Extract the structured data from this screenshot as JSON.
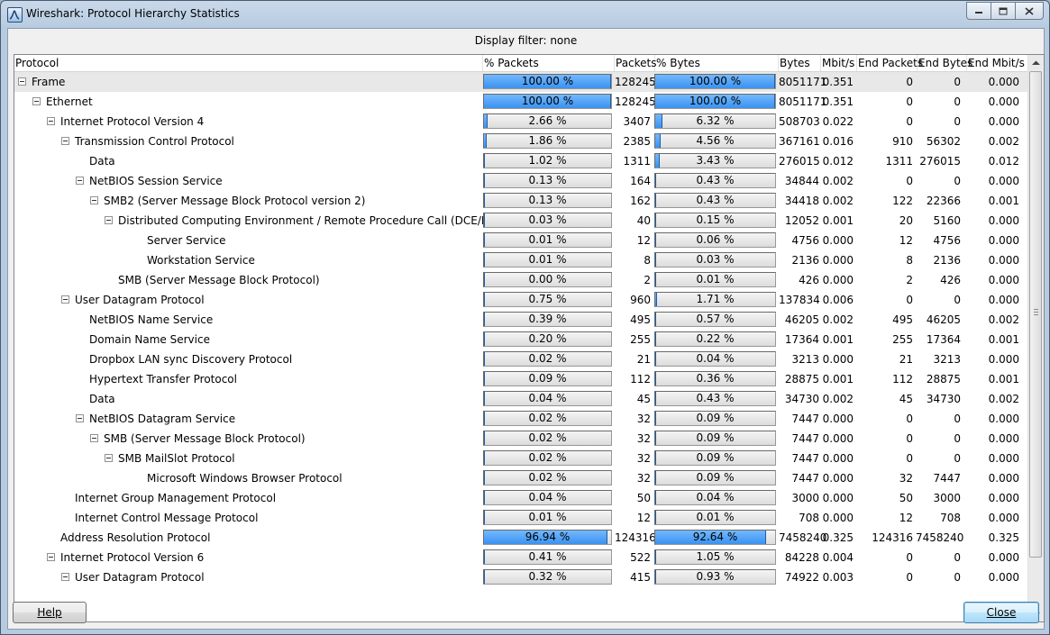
{
  "window": {
    "title": "Wireshark: Protocol Hierarchy Statistics"
  },
  "filter_text": "Display filter: none",
  "columns": [
    "Protocol",
    "% Packets",
    "Packets",
    "% Bytes",
    "Bytes",
    "Mbit/s",
    "End Packets",
    "End Bytes",
    "End Mbit/s"
  ],
  "rows": [
    {
      "protocol": "Frame",
      "level": 0,
      "expander": true,
      "selected": true,
      "pct_packets": "100.00 %",
      "pct_packets_value": 100.0,
      "packets": "128245",
      "pct_bytes": "100.00 %",
      "pct_bytes_value": 100.0,
      "bytes": "8051171",
      "mbits": "0.351",
      "end_packets": "0",
      "end_bytes": "0",
      "end_mbits": "0.000"
    },
    {
      "protocol": "Ethernet",
      "level": 1,
      "expander": true,
      "pct_packets": "100.00 %",
      "pct_packets_value": 100.0,
      "packets": "128245",
      "pct_bytes": "100.00 %",
      "pct_bytes_value": 100.0,
      "bytes": "8051171",
      "mbits": "0.351",
      "end_packets": "0",
      "end_bytes": "0",
      "end_mbits": "0.000"
    },
    {
      "protocol": "Internet Protocol Version 4",
      "level": 2,
      "expander": true,
      "pct_packets": "2.66 %",
      "pct_packets_value": 2.66,
      "packets": "3407",
      "pct_bytes": "6.32 %",
      "pct_bytes_value": 6.32,
      "bytes": "508703",
      "mbits": "0.022",
      "end_packets": "0",
      "end_bytes": "0",
      "end_mbits": "0.000"
    },
    {
      "protocol": "Transmission Control Protocol",
      "level": 3,
      "expander": true,
      "pct_packets": "1.86 %",
      "pct_packets_value": 1.86,
      "packets": "2385",
      "pct_bytes": "4.56 %",
      "pct_bytes_value": 4.56,
      "bytes": "367161",
      "mbits": "0.016",
      "end_packets": "910",
      "end_bytes": "56302",
      "end_mbits": "0.002"
    },
    {
      "protocol": "Data",
      "level": 4,
      "expander": false,
      "pct_packets": "1.02 %",
      "pct_packets_value": 1.02,
      "packets": "1311",
      "pct_bytes": "3.43 %",
      "pct_bytes_value": 3.43,
      "bytes": "276015",
      "mbits": "0.012",
      "end_packets": "1311",
      "end_bytes": "276015",
      "end_mbits": "0.012"
    },
    {
      "protocol": "NetBIOS Session Service",
      "level": 4,
      "expander": true,
      "pct_packets": "0.13 %",
      "pct_packets_value": 0.13,
      "packets": "164",
      "pct_bytes": "0.43 %",
      "pct_bytes_value": 0.43,
      "bytes": "34844",
      "mbits": "0.002",
      "end_packets": "0",
      "end_bytes": "0",
      "end_mbits": "0.000"
    },
    {
      "protocol": "SMB2 (Server Message Block Protocol version 2)",
      "level": 5,
      "expander": true,
      "pct_packets": "0.13 %",
      "pct_packets_value": 0.13,
      "packets": "162",
      "pct_bytes": "0.43 %",
      "pct_bytes_value": 0.43,
      "bytes": "34418",
      "mbits": "0.002",
      "end_packets": "122",
      "end_bytes": "22366",
      "end_mbits": "0.001"
    },
    {
      "protocol": "Distributed Computing Environment / Remote Procedure Call (DCE/RPC)",
      "level": 6,
      "expander": true,
      "pct_packets": "0.03 %",
      "pct_packets_value": 0.03,
      "packets": "40",
      "pct_bytes": "0.15 %",
      "pct_bytes_value": 0.15,
      "bytes": "12052",
      "mbits": "0.001",
      "end_packets": "20",
      "end_bytes": "5160",
      "end_mbits": "0.000"
    },
    {
      "protocol": "Server Service",
      "level": 8,
      "expander": false,
      "pct_packets": "0.01 %",
      "pct_packets_value": 0.01,
      "packets": "12",
      "pct_bytes": "0.06 %",
      "pct_bytes_value": 0.06,
      "bytes": "4756",
      "mbits": "0.000",
      "end_packets": "12",
      "end_bytes": "4756",
      "end_mbits": "0.000"
    },
    {
      "protocol": "Workstation Service",
      "level": 8,
      "expander": false,
      "pct_packets": "0.01 %",
      "pct_packets_value": 0.01,
      "packets": "8",
      "pct_bytes": "0.03 %",
      "pct_bytes_value": 0.03,
      "bytes": "2136",
      "mbits": "0.000",
      "end_packets": "8",
      "end_bytes": "2136",
      "end_mbits": "0.000"
    },
    {
      "protocol": "SMB (Server Message Block Protocol)",
      "level": 6,
      "expander": false,
      "pct_packets": "0.00 %",
      "pct_packets_value": 0.0,
      "packets": "2",
      "pct_bytes": "0.01 %",
      "pct_bytes_value": 0.01,
      "bytes": "426",
      "mbits": "0.000",
      "end_packets": "2",
      "end_bytes": "426",
      "end_mbits": "0.000"
    },
    {
      "protocol": "User Datagram Protocol",
      "level": 3,
      "expander": true,
      "pct_packets": "0.75 %",
      "pct_packets_value": 0.75,
      "packets": "960",
      "pct_bytes": "1.71 %",
      "pct_bytes_value": 1.71,
      "bytes": "137834",
      "mbits": "0.006",
      "end_packets": "0",
      "end_bytes": "0",
      "end_mbits": "0.000"
    },
    {
      "protocol": "NetBIOS Name Service",
      "level": 4,
      "expander": false,
      "pct_packets": "0.39 %",
      "pct_packets_value": 0.39,
      "packets": "495",
      "pct_bytes": "0.57 %",
      "pct_bytes_value": 0.57,
      "bytes": "46205",
      "mbits": "0.002",
      "end_packets": "495",
      "end_bytes": "46205",
      "end_mbits": "0.002"
    },
    {
      "protocol": "Domain Name Service",
      "level": 4,
      "expander": false,
      "pct_packets": "0.20 %",
      "pct_packets_value": 0.2,
      "packets": "255",
      "pct_bytes": "0.22 %",
      "pct_bytes_value": 0.22,
      "bytes": "17364",
      "mbits": "0.001",
      "end_packets": "255",
      "end_bytes": "17364",
      "end_mbits": "0.001"
    },
    {
      "protocol": "Dropbox LAN sync Discovery Protocol",
      "level": 4,
      "expander": false,
      "pct_packets": "0.02 %",
      "pct_packets_value": 0.02,
      "packets": "21",
      "pct_bytes": "0.04 %",
      "pct_bytes_value": 0.04,
      "bytes": "3213",
      "mbits": "0.000",
      "end_packets": "21",
      "end_bytes": "3213",
      "end_mbits": "0.000"
    },
    {
      "protocol": "Hypertext Transfer Protocol",
      "level": 4,
      "expander": false,
      "pct_packets": "0.09 %",
      "pct_packets_value": 0.09,
      "packets": "112",
      "pct_bytes": "0.36 %",
      "pct_bytes_value": 0.36,
      "bytes": "28875",
      "mbits": "0.001",
      "end_packets": "112",
      "end_bytes": "28875",
      "end_mbits": "0.001"
    },
    {
      "protocol": "Data",
      "level": 4,
      "expander": false,
      "pct_packets": "0.04 %",
      "pct_packets_value": 0.04,
      "packets": "45",
      "pct_bytes": "0.43 %",
      "pct_bytes_value": 0.43,
      "bytes": "34730",
      "mbits": "0.002",
      "end_packets": "45",
      "end_bytes": "34730",
      "end_mbits": "0.002"
    },
    {
      "protocol": "NetBIOS Datagram Service",
      "level": 4,
      "expander": true,
      "pct_packets": "0.02 %",
      "pct_packets_value": 0.02,
      "packets": "32",
      "pct_bytes": "0.09 %",
      "pct_bytes_value": 0.09,
      "bytes": "7447",
      "mbits": "0.000",
      "end_packets": "0",
      "end_bytes": "0",
      "end_mbits": "0.000"
    },
    {
      "protocol": "SMB (Server Message Block Protocol)",
      "level": 5,
      "expander": true,
      "pct_packets": "0.02 %",
      "pct_packets_value": 0.02,
      "packets": "32",
      "pct_bytes": "0.09 %",
      "pct_bytes_value": 0.09,
      "bytes": "7447",
      "mbits": "0.000",
      "end_packets": "0",
      "end_bytes": "0",
      "end_mbits": "0.000"
    },
    {
      "protocol": "SMB MailSlot Protocol",
      "level": 6,
      "expander": true,
      "pct_packets": "0.02 %",
      "pct_packets_value": 0.02,
      "packets": "32",
      "pct_bytes": "0.09 %",
      "pct_bytes_value": 0.09,
      "bytes": "7447",
      "mbits": "0.000",
      "end_packets": "0",
      "end_bytes": "0",
      "end_mbits": "0.000"
    },
    {
      "protocol": "Microsoft Windows Browser Protocol",
      "level": 8,
      "expander": false,
      "pct_packets": "0.02 %",
      "pct_packets_value": 0.02,
      "packets": "32",
      "pct_bytes": "0.09 %",
      "pct_bytes_value": 0.09,
      "bytes": "7447",
      "mbits": "0.000",
      "end_packets": "32",
      "end_bytes": "7447",
      "end_mbits": "0.000"
    },
    {
      "protocol": "Internet Group Management Protocol",
      "level": 3,
      "expander": false,
      "pct_packets": "0.04 %",
      "pct_packets_value": 0.04,
      "packets": "50",
      "pct_bytes": "0.04 %",
      "pct_bytes_value": 0.04,
      "bytes": "3000",
      "mbits": "0.000",
      "end_packets": "50",
      "end_bytes": "3000",
      "end_mbits": "0.000"
    },
    {
      "protocol": "Internet Control Message Protocol",
      "level": 3,
      "expander": false,
      "pct_packets": "0.01 %",
      "pct_packets_value": 0.01,
      "packets": "12",
      "pct_bytes": "0.01 %",
      "pct_bytes_value": 0.01,
      "bytes": "708",
      "mbits": "0.000",
      "end_packets": "12",
      "end_bytes": "708",
      "end_mbits": "0.000"
    },
    {
      "protocol": "Address Resolution Protocol",
      "level": 2,
      "expander": false,
      "pct_packets": "96.94 %",
      "pct_packets_value": 96.94,
      "packets": "124316",
      "pct_bytes": "92.64 %",
      "pct_bytes_value": 92.64,
      "bytes": "7458240",
      "mbits": "0.325",
      "end_packets": "124316",
      "end_bytes": "7458240",
      "end_mbits": "0.325"
    },
    {
      "protocol": "Internet Protocol Version 6",
      "level": 2,
      "expander": true,
      "pct_packets": "0.41 %",
      "pct_packets_value": 0.41,
      "packets": "522",
      "pct_bytes": "1.05 %",
      "pct_bytes_value": 1.05,
      "bytes": "84228",
      "mbits": "0.004",
      "end_packets": "0",
      "end_bytes": "0",
      "end_mbits": "0.000"
    },
    {
      "protocol": "User Datagram Protocol",
      "level": 3,
      "expander": true,
      "pct_packets": "0.32 %",
      "pct_packets_value": 0.32,
      "packets": "415",
      "pct_bytes": "0.93 %",
      "pct_bytes_value": 0.93,
      "bytes": "74922",
      "mbits": "0.003",
      "end_packets": "0",
      "end_bytes": "0",
      "end_mbits": "0.000"
    }
  ],
  "buttons": {
    "help": "Help",
    "close": "Close"
  },
  "colors": {
    "bar_fill": "#3a92f0",
    "selection": "#e8e8e8"
  }
}
